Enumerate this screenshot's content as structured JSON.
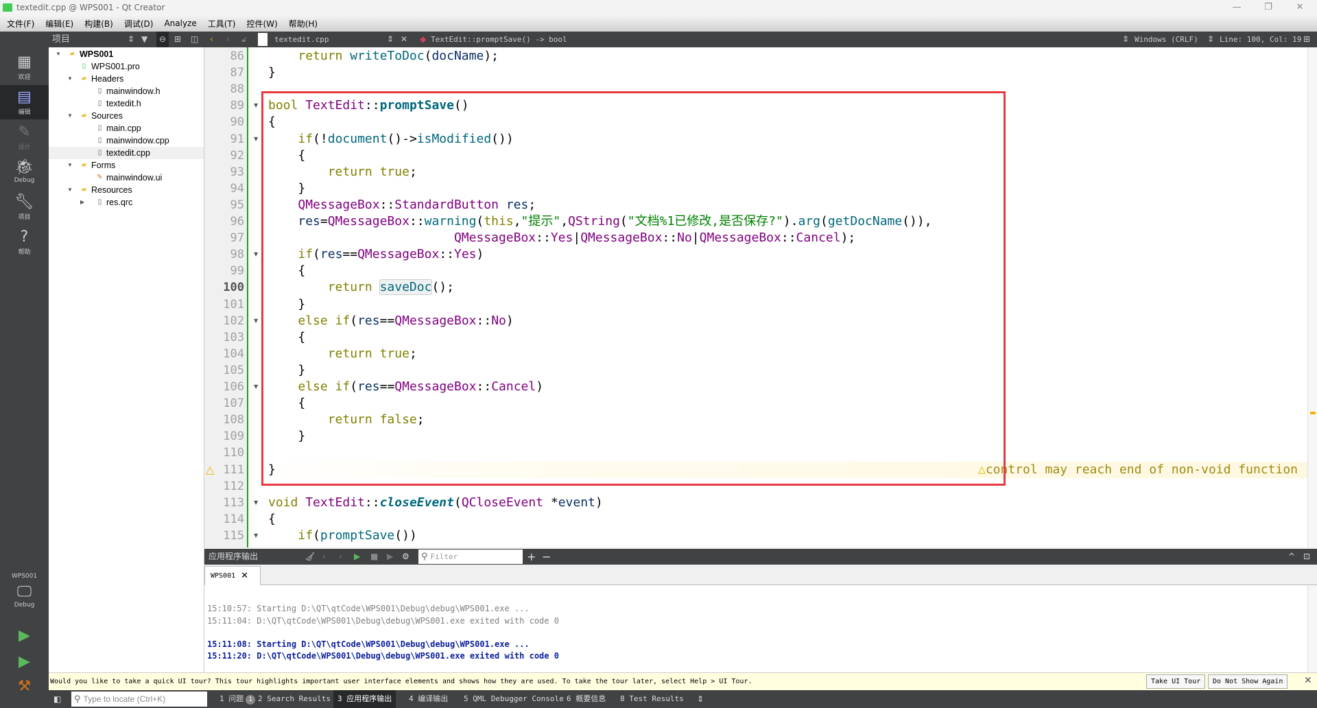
{
  "window": {
    "title": "textedit.cpp @ WPS001 - Qt Creator",
    "app_icon": "QC"
  },
  "menu": [
    "文件(F)",
    "编辑(E)",
    "构建(B)",
    "调试(D)",
    "Analyze",
    "工具(T)",
    "控件(W)",
    "帮助(H)"
  ],
  "toolbar": {
    "panel_label": "项目",
    "file": "textedit.cpp",
    "symbol": "TextEdit::promptSave() -> bool",
    "line_ending": "Windows (CRLF)",
    "position": "Line: 100, Col: 19"
  },
  "modes": [
    {
      "label": "欢迎",
      "icon": "grid-icon"
    },
    {
      "label": "编辑",
      "icon": "edit-icon",
      "active": true
    },
    {
      "label": "设计",
      "icon": "pencil-icon",
      "disabled": true
    },
    {
      "label": "Debug",
      "icon": "bug-icon"
    },
    {
      "label": "项目",
      "icon": "wrench-icon"
    },
    {
      "label": "帮助",
      "icon": "help-icon"
    }
  ],
  "kit": {
    "project": "WPS001",
    "config": "Debug"
  },
  "tree": [
    {
      "label": "WPS001",
      "level": 0,
      "expanded": true,
      "bold": true,
      "icon": "qt-project-icon"
    },
    {
      "label": "WPS001.pro",
      "level": 1,
      "icon": "pro-file-icon"
    },
    {
      "label": "Headers",
      "level": 1,
      "expanded": true,
      "icon": "headers-folder-icon"
    },
    {
      "label": "mainwindow.h",
      "level": 2,
      "icon": "header-file-icon"
    },
    {
      "label": "textedit.h",
      "level": 2,
      "icon": "header-file-icon"
    },
    {
      "label": "Sources",
      "level": 1,
      "expanded": true,
      "icon": "sources-folder-icon"
    },
    {
      "label": "main.cpp",
      "level": 2,
      "icon": "cpp-file-icon"
    },
    {
      "label": "mainwindow.cpp",
      "level": 2,
      "icon": "cpp-file-icon"
    },
    {
      "label": "textedit.cpp",
      "level": 2,
      "icon": "cpp-file-icon",
      "selected": true
    },
    {
      "label": "Forms",
      "level": 1,
      "expanded": true,
      "icon": "forms-folder-icon"
    },
    {
      "label": "mainwindow.ui",
      "level": 2,
      "icon": "ui-file-icon"
    },
    {
      "label": "Resources",
      "level": 1,
      "expanded": true,
      "icon": "resources-folder-icon"
    },
    {
      "label": "res.qrc",
      "level": 2,
      "collapsed": true,
      "icon": "qrc-file-icon"
    }
  ],
  "editor": {
    "first_line": 86,
    "current_line": 100,
    "fold_lines": [
      89,
      91,
      98,
      102,
      106,
      113,
      115
    ],
    "warning": {
      "line": 111,
      "text": "control may reach end of non-void function"
    },
    "lines": [
      [
        [
          "    ",
          "p"
        ],
        [
          "return",
          "k"
        ],
        [
          " ",
          "p"
        ],
        [
          "writeToDoc",
          "f"
        ],
        [
          "(",
          "p"
        ],
        [
          "docName",
          "v"
        ],
        [
          ");",
          "p"
        ]
      ],
      [
        [
          "}",
          "p"
        ]
      ],
      [],
      [
        [
          "bool",
          "k"
        ],
        [
          " ",
          "p"
        ],
        [
          "TextEdit",
          "t"
        ],
        [
          "::",
          "p"
        ],
        [
          "promptSave",
          "fb"
        ],
        [
          "()",
          "p"
        ]
      ],
      [
        [
          "{",
          "p"
        ]
      ],
      [
        [
          "    ",
          "p"
        ],
        [
          "if",
          "k"
        ],
        [
          "(!",
          "p"
        ],
        [
          "document",
          "f"
        ],
        [
          "()->",
          "p"
        ],
        [
          "isModified",
          "f"
        ],
        [
          "())",
          "p"
        ]
      ],
      [
        [
          "    {",
          "p"
        ]
      ],
      [
        [
          "        ",
          "p"
        ],
        [
          "return",
          "k"
        ],
        [
          " ",
          "p"
        ],
        [
          "true",
          "k"
        ],
        [
          ";",
          "p"
        ]
      ],
      [
        [
          "    }",
          "p"
        ]
      ],
      [
        [
          "    ",
          "p"
        ],
        [
          "QMessageBox",
          "t"
        ],
        [
          "::",
          "p"
        ],
        [
          "StandardButton",
          "t"
        ],
        [
          " ",
          "p"
        ],
        [
          "res",
          "v"
        ],
        [
          ";",
          "p"
        ]
      ],
      [
        [
          "    ",
          "p"
        ],
        [
          "res",
          "v"
        ],
        [
          "=",
          "p"
        ],
        [
          "QMessageBox",
          "t"
        ],
        [
          "::",
          "p"
        ],
        [
          "warning",
          "f"
        ],
        [
          "(",
          "p"
        ],
        [
          "this",
          "k"
        ],
        [
          ",",
          "p"
        ],
        [
          "\"提示\"",
          "s"
        ],
        [
          ",",
          "p"
        ],
        [
          "QString",
          "t"
        ],
        [
          "(",
          "p"
        ],
        [
          "\"文档%1已修改,是否保存?\"",
          "s"
        ],
        [
          ").",
          "p"
        ],
        [
          "arg",
          "f"
        ],
        [
          "(",
          "p"
        ],
        [
          "getDocName",
          "f"
        ],
        [
          "()),",
          "p"
        ]
      ],
      [
        [
          "                         ",
          "p"
        ],
        [
          "QMessageBox",
          "t"
        ],
        [
          "::",
          "p"
        ],
        [
          "Yes",
          "t"
        ],
        [
          "|",
          "p"
        ],
        [
          "QMessageBox",
          "t"
        ],
        [
          "::",
          "p"
        ],
        [
          "No",
          "t"
        ],
        [
          "|",
          "p"
        ],
        [
          "QMessageBox",
          "t"
        ],
        [
          "::",
          "p"
        ],
        [
          "Cancel",
          "t"
        ],
        [
          ");",
          "p"
        ]
      ],
      [
        [
          "    ",
          "p"
        ],
        [
          "if",
          "k"
        ],
        [
          "(",
          "p"
        ],
        [
          "res",
          "v"
        ],
        [
          "==",
          "p"
        ],
        [
          "QMessageBox",
          "t"
        ],
        [
          "::",
          "p"
        ],
        [
          "Yes",
          "t"
        ],
        [
          ")",
          "p"
        ]
      ],
      [
        [
          "    {",
          "p"
        ]
      ],
      [
        [
          "        ",
          "p"
        ],
        [
          "return",
          "k"
        ],
        [
          " ",
          "p"
        ],
        [
          "saveDoc",
          "fh"
        ],
        [
          "();",
          "p"
        ]
      ],
      [
        [
          "    }",
          "p"
        ]
      ],
      [
        [
          "    ",
          "p"
        ],
        [
          "else",
          "k"
        ],
        [
          " ",
          "p"
        ],
        [
          "if",
          "k"
        ],
        [
          "(",
          "p"
        ],
        [
          "res",
          "v"
        ],
        [
          "==",
          "p"
        ],
        [
          "QMessageBox",
          "t"
        ],
        [
          "::",
          "p"
        ],
        [
          "No",
          "t"
        ],
        [
          ")",
          "p"
        ]
      ],
      [
        [
          "    {",
          "p"
        ]
      ],
      [
        [
          "        ",
          "p"
        ],
        [
          "return",
          "k"
        ],
        [
          " ",
          "p"
        ],
        [
          "true",
          "k"
        ],
        [
          ";",
          "p"
        ]
      ],
      [
        [
          "    }",
          "p"
        ]
      ],
      [
        [
          "    ",
          "p"
        ],
        [
          "else",
          "k"
        ],
        [
          " ",
          "p"
        ],
        [
          "if",
          "k"
        ],
        [
          "(",
          "p"
        ],
        [
          "res",
          "v"
        ],
        [
          "==",
          "p"
        ],
        [
          "QMessageBox",
          "t"
        ],
        [
          "::",
          "p"
        ],
        [
          "Cancel",
          "t"
        ],
        [
          ")",
          "p"
        ]
      ],
      [
        [
          "    {",
          "p"
        ]
      ],
      [
        [
          "        ",
          "p"
        ],
        [
          "return",
          "k"
        ],
        [
          " ",
          "p"
        ],
        [
          "false",
          "k"
        ],
        [
          ";",
          "p"
        ]
      ],
      [
        [
          "    }",
          "p"
        ]
      ],
      [],
      [
        [
          "}",
          "p"
        ]
      ],
      [],
      [
        [
          "void",
          "k"
        ],
        [
          " ",
          "p"
        ],
        [
          "TextEdit",
          "t"
        ],
        [
          "::",
          "p"
        ],
        [
          "closeEvent",
          "fi"
        ],
        [
          "(",
          "p"
        ],
        [
          "QCloseEvent",
          "t"
        ],
        [
          " *",
          "p"
        ],
        [
          "event",
          "v"
        ],
        [
          ")",
          "p"
        ]
      ],
      [
        [
          "{",
          "p"
        ]
      ],
      [
        [
          "    ",
          "p"
        ],
        [
          "if",
          "k"
        ],
        [
          "(",
          "p"
        ],
        [
          "promptSave",
          "f"
        ],
        [
          "())",
          "p"
        ]
      ]
    ]
  },
  "output": {
    "title": "应用程序输出",
    "filter_placeholder": "Filter",
    "tab": "WPS001",
    "lines": [
      {
        "text": "15:10:57: Starting D:\\QT\\qtCode\\WPS001\\Debug\\debug\\WPS001.exe ...",
        "style": "old"
      },
      {
        "text": "15:11:04: D:\\QT\\qtCode\\WPS001\\Debug\\debug\\WPS001.exe exited with code 0",
        "style": "old"
      },
      {
        "text": "15:11:08: Starting D:\\QT\\qtCode\\WPS001\\Debug\\debug\\WPS001.exe ...",
        "style": "new"
      },
      {
        "text": "15:11:20: D:\\QT\\qtCode\\WPS001\\Debug\\debug\\WPS001.exe exited with code 0",
        "style": "new"
      }
    ]
  },
  "tour": {
    "message": "Would you like to take a quick UI tour? This tour highlights important user interface elements and shows how they are used. To take the tour later, select Help > UI Tour.",
    "take": "Take UI Tour",
    "dismiss": "Do Not Show Again"
  },
  "status": {
    "locate_placeholder": "Type to locate (Ctrl+K)",
    "issues_badge": "1",
    "tabs": [
      "1 问题",
      "2 Search Results",
      "3 应用程序输出",
      "4 编译输出",
      "5 QML Debugger Console",
      "6 概要信息",
      "8 Test Results"
    ],
    "active_tab": 2
  },
  "colors": {
    "highlight_box": "#e8373e",
    "keyword": "#808000",
    "type": "#800080",
    "function": "#00677c",
    "string": "#008000",
    "output_new": "#0a1e9a",
    "output_old": "#808080"
  }
}
